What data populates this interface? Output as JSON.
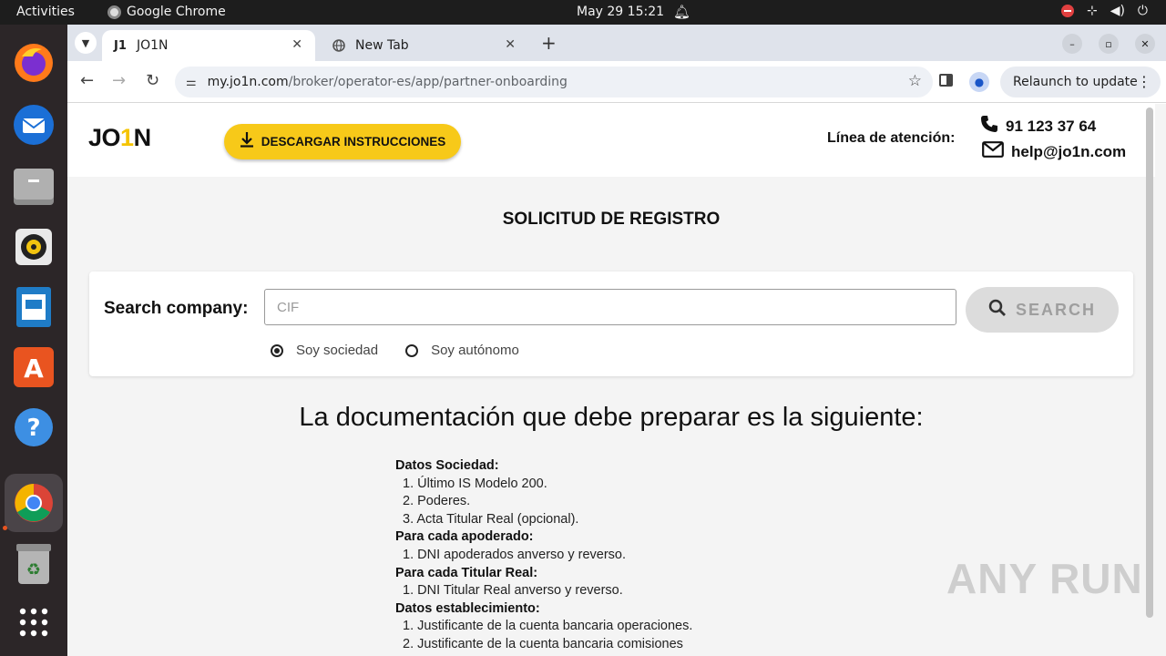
{
  "system": {
    "activities": "Activities",
    "app_name": "Google Chrome",
    "clock": "May 29  15:21"
  },
  "browser": {
    "tabs": [
      {
        "label": "JO1N",
        "favicon": "J1"
      },
      {
        "label": "New Tab"
      }
    ],
    "url_host": "my.jo1n.com",
    "url_path": "/broker/operator-es/app/partner-onboarding",
    "relaunch_label": "Relaunch to update"
  },
  "site": {
    "logo_pre": "JO",
    "logo_one": "1",
    "logo_post": "N",
    "download_label": "DESCARGAR INSTRUCCIONES",
    "support_label": "Línea de atención:",
    "phone": "91 123 37 64",
    "email": "help@jo1n.com"
  },
  "page": {
    "title": "SOLICITUD DE REGISTRO",
    "search_label": "Search company:",
    "search_placeholder": "CIF",
    "search_button": "SEARCH",
    "radio_company": "Soy sociedad",
    "radio_freelancer": "Soy autónomo",
    "radio_selected": "Soy sociedad",
    "doc_heading": "La documentación que debe preparar es la siguiente:",
    "sections": [
      {
        "title": "Datos Sociedad:",
        "items": [
          "Último IS Modelo 200.",
          "Poderes.",
          "Acta Titular Real (opcional)."
        ]
      },
      {
        "title": "Para cada apoderado:",
        "items": [
          "DNI apoderados anverso y reverso."
        ]
      },
      {
        "title": "Para cada Titular Real:",
        "items": [
          "DNI Titular Real anverso y reverso."
        ]
      },
      {
        "title": "Datos establecimiento:",
        "items": [
          "Justificante de la cuenta bancaria operaciones.",
          "Justificante de la cuenta bancaria comisiones"
        ]
      }
    ]
  },
  "watermark": "ANY RUN",
  "colors": {
    "brand_yellow": "#f7c919",
    "topbar": "#1d1d1d",
    "dock": "#2c2628"
  }
}
